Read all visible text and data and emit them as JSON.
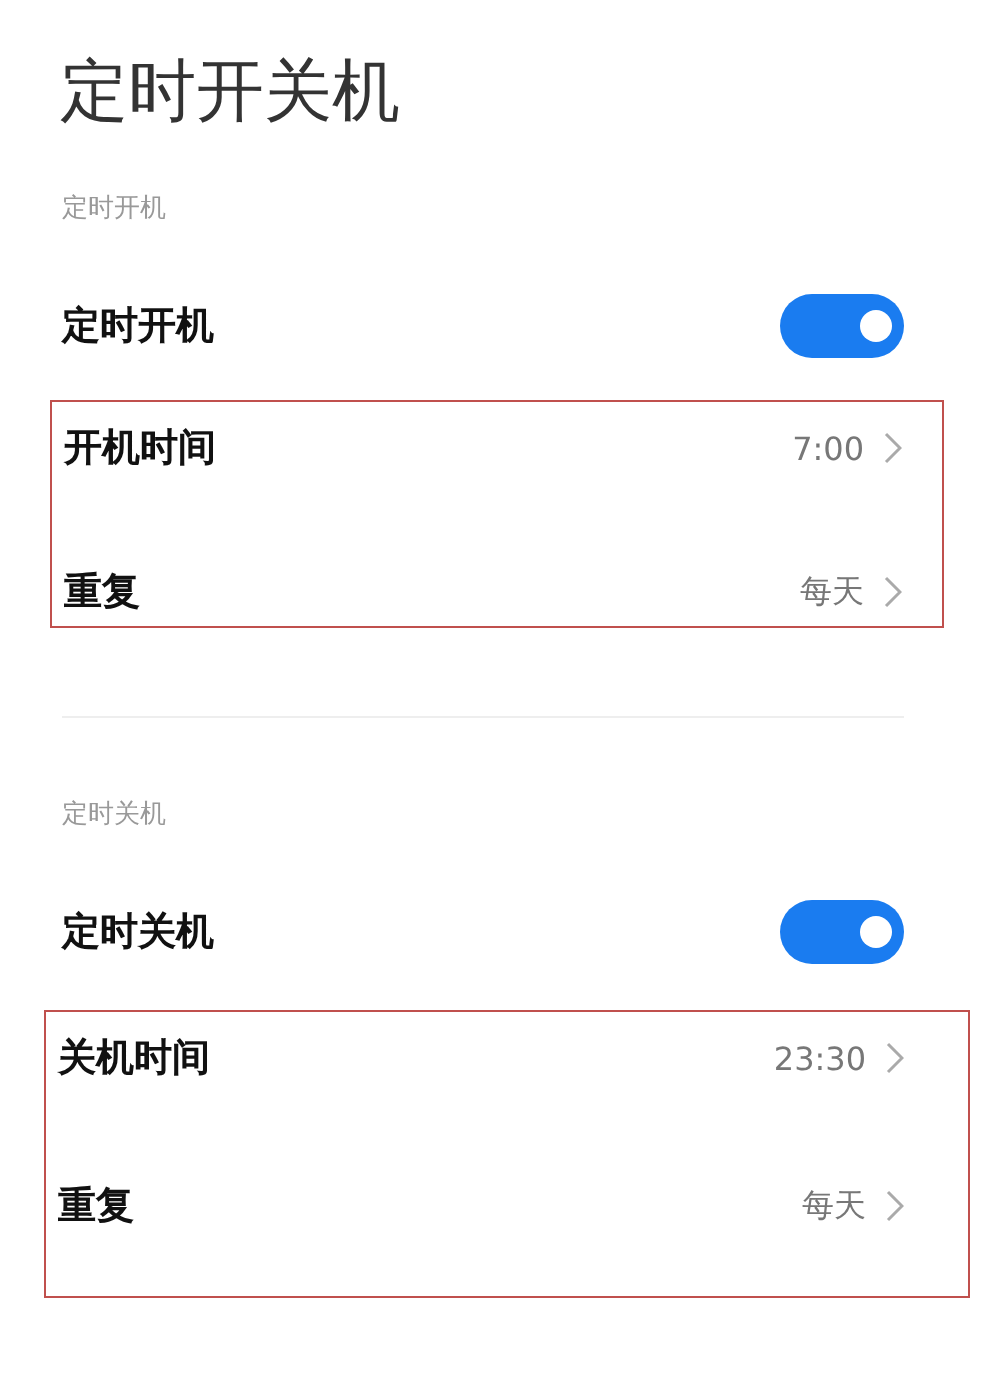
{
  "title": "定时开关机",
  "sections": [
    {
      "label": "定时开机",
      "toggle": {
        "label": "定时开机",
        "on": true
      },
      "highlighted": true,
      "rows": [
        {
          "label": "开机时间",
          "value": "7:00"
        },
        {
          "label": "重复",
          "value": "每天"
        }
      ]
    },
    {
      "label": "定时关机",
      "toggle": {
        "label": "定时关机",
        "on": true
      },
      "highlighted": true,
      "rows": [
        {
          "label": "关机时间",
          "value": "23:30"
        },
        {
          "label": "重复",
          "value": "每天"
        }
      ]
    }
  ]
}
